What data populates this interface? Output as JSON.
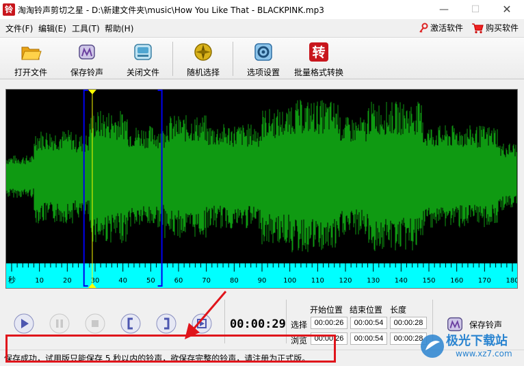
{
  "window": {
    "app_icon_char": "铃",
    "title": "淘淘铃声剪切之星 - D:\\新建文件夹\\music\\How You Like That - BLACKPINK.mp3",
    "minimize": "—",
    "maximize": "☐",
    "close": "✕"
  },
  "menu": {
    "items": [
      "文件(F)",
      "编辑(E)",
      "工具(T)",
      "帮助(H)"
    ],
    "activate_label": "激活软件",
    "buy_label": "购买软件"
  },
  "toolbar": {
    "buttons": [
      {
        "label": "打开文件",
        "icon": "folder-icon"
      },
      {
        "label": "保存铃声",
        "icon": "save-ringtone-icon"
      },
      {
        "label": "关闭文件",
        "icon": "close-file-icon"
      },
      {
        "label": "随机选择",
        "icon": "random-select-icon"
      },
      {
        "label": "选项设置",
        "icon": "settings-icon"
      },
      {
        "label": "批量格式转换",
        "icon": "convert-icon"
      }
    ],
    "convert_icon_char": "转"
  },
  "waveform": {
    "ruler_unit": "秒",
    "ruler_ticks": [
      "10",
      "20",
      "30",
      "40",
      "50",
      "60",
      "70",
      "80",
      "90",
      "100",
      "110",
      "120",
      "130",
      "140",
      "150",
      "160",
      "170",
      "180"
    ],
    "selection_start_seconds": 26,
    "selection_end_seconds": 54,
    "playhead_seconds": 29,
    "duration_seconds": 180,
    "colors": {
      "wave": "#0f9a12",
      "ruler": "#00ffff",
      "selection": "#0000ee",
      "playhead": "#ffff00"
    }
  },
  "transport": {
    "time": "00:00:29",
    "col_start": "开始位置",
    "col_end": "结束位置",
    "col_length": "长度",
    "row_select_label": "选择",
    "row_preview_label": "浏览",
    "select_start": "00:00:26",
    "select_end": "00:00:54",
    "select_length": "00:00:28",
    "preview_start": "00:00:26",
    "preview_end": "00:00:54",
    "preview_length": "00:00:28",
    "save_label": "保存铃声"
  },
  "status": {
    "text": "保存成功，试用版只能保存 5 秒以内的铃声，欲保存完整的铃声，请注册为正式版。"
  },
  "watermark": {
    "name": "极光下载站",
    "url": "www.xz7.com"
  }
}
